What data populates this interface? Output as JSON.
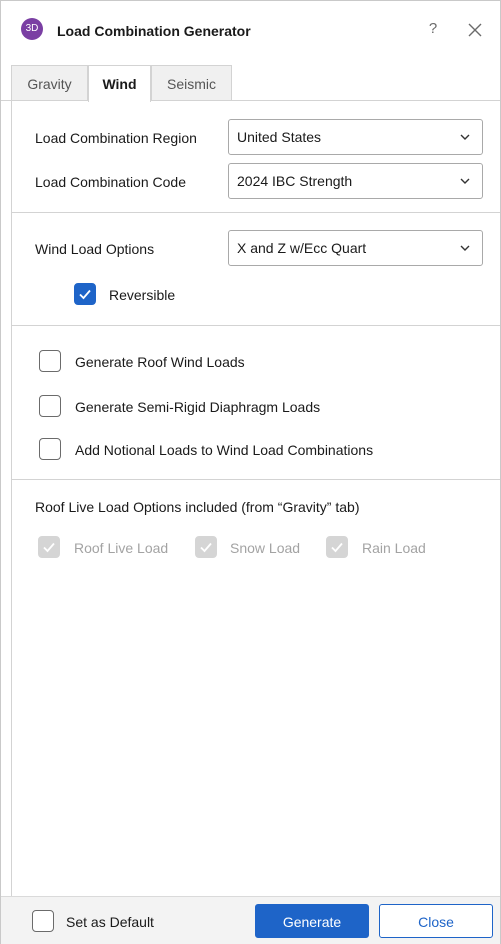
{
  "window": {
    "icon_text": "3D",
    "title": "Load Combination Generator",
    "help_label": "?"
  },
  "tabs": [
    {
      "label": "Gravity",
      "active": false
    },
    {
      "label": "Wind",
      "active": true
    },
    {
      "label": "Seismic",
      "active": false
    }
  ],
  "region": {
    "label": "Load Combination Region",
    "value": "United States"
  },
  "code": {
    "label": "Load Combination Code",
    "value": "2024 IBC Strength"
  },
  "wind": {
    "label": "Wind Load Options",
    "value": "X and Z w/Ecc Quart",
    "reversible_label": "Reversible",
    "reversible_checked": true
  },
  "options": [
    {
      "label": "Generate Roof Wind Loads",
      "checked": false
    },
    {
      "label": "Generate Semi-Rigid Diaphragm Loads",
      "checked": false
    },
    {
      "label": "Add Notional Loads to Wind Load Combinations",
      "checked": false
    }
  ],
  "roof_live": {
    "heading": "Roof Live Load Options included (from “Gravity” tab)",
    "items": [
      {
        "label": "Roof Live Load",
        "checked": true,
        "disabled": true
      },
      {
        "label": "Snow Load",
        "checked": true,
        "disabled": true
      },
      {
        "label": "Rain Load",
        "checked": true,
        "disabled": true
      }
    ]
  },
  "footer": {
    "default_label": "Set as Default",
    "default_checked": false,
    "generate_label": "Generate",
    "close_label": "Close"
  },
  "colors": {
    "accent": "#1e64c8",
    "app_icon": "#7a3fa3",
    "disabled_check": "#d5d5d5"
  }
}
